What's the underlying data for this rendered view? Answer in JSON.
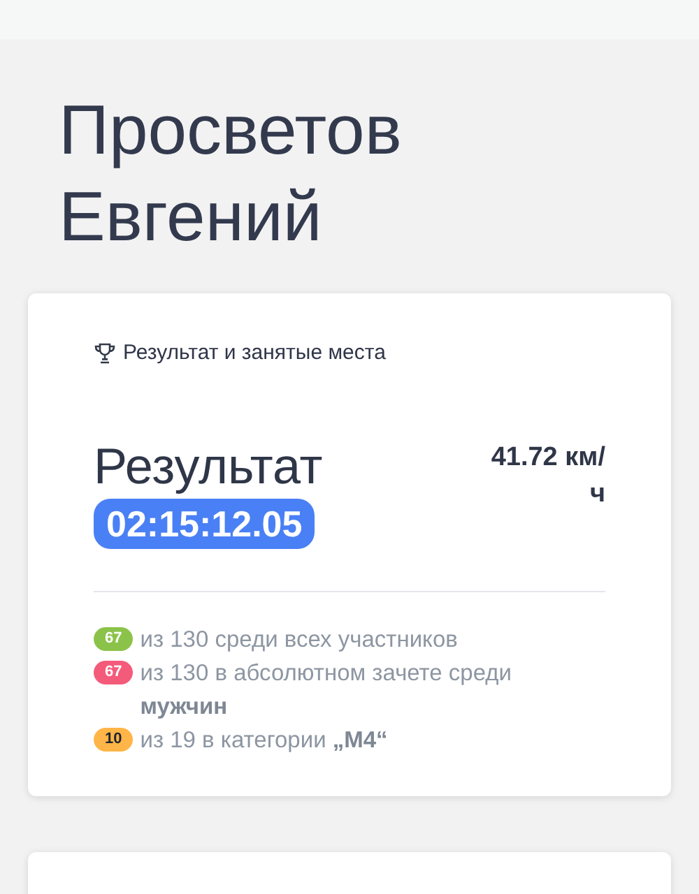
{
  "athlete": {
    "name": "Просветов Евгений"
  },
  "result_card": {
    "title": "Результат и занятые места",
    "result_label": "Результат",
    "time": "02:15:12.05",
    "speed": "41.72 км/ч",
    "ranks": [
      {
        "place": "67",
        "color": "#8bc34a",
        "text": "из 130 среди всех участников"
      },
      {
        "place": "67",
        "color": "#f45b7a",
        "text": "из 130 в абсолютном зачете среди **мужчин**"
      },
      {
        "place": "10",
        "color": "#ffb547",
        "text": "из 19 в категории **„M4“**"
      }
    ]
  }
}
